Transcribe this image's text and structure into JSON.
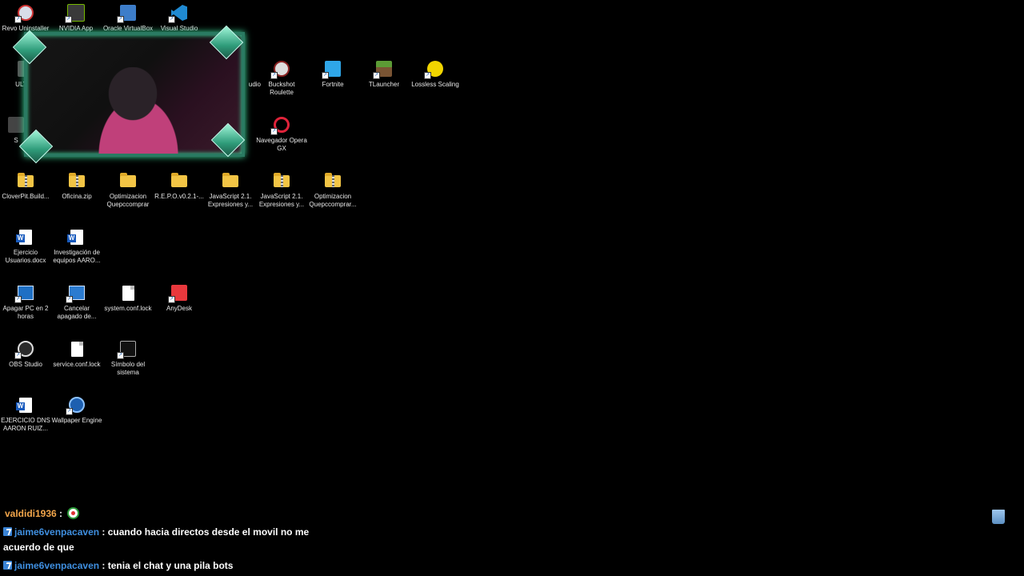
{
  "desktop": {
    "icons": {
      "revo": "Revo Uninstaller",
      "nvidia": "NVIDIA App",
      "virtualbox": "Oracle VirtualBox",
      "vscode": "Visual Studio Code",
      "buckshot": "Buckshot Roulette",
      "fortnite": "Fortnite",
      "tlauncher": "TLauncher",
      "lossless": "Lossless Scaling",
      "opera": "Navegador Opera GX",
      "cloverpit": "CloverPit.Build...",
      "oficina": "Oficina.zip",
      "optim1": "Optimizacion Quepccomprar",
      "repo": "R.E.P.O.v0.2.1-...",
      "js1": "JavaScript 2.1. Expresiones y...",
      "js2": "JavaScript 2.1. Expresiones y...",
      "optim2": "Optimizacion Quepccomprar...",
      "ejercicio_usuarios": "Ejercicio Usuarios.docx",
      "investigacion": "Investigación de equipos AARO...",
      "apagar": "Apagar PC en 2 horas",
      "cancelar": "Cancelar apagado de...",
      "sysconf": "system.conf.lock",
      "anydesk": "AnyDesk",
      "obs": "OBS Studio",
      "serviceconf": "service.conf.lock",
      "cmd": "Símbolo del sistema",
      "ejercicio_dns": "EJERCICIO DNS AARON RUIZ...",
      "wallpaper": "Wallpaper Engine",
      "partial_ultra": "ULTRA",
      "partial_s": "S",
      "partial_studio": "udio"
    }
  },
  "chat": {
    "messages": [
      {
        "user": "valdidi1936",
        "sep": " :",
        "text": ""
      },
      {
        "user": "jaime6venpacaven",
        "sep": " :",
        "text": " cuando hacia directos desde el movil no me acuerdo de que"
      },
      {
        "user": "jaime6venpacaven",
        "sep": " :",
        "text": " tenia el chat y una pila bots"
      }
    ]
  },
  "colors": {
    "user_orange": "#f2a64b",
    "user_blue": "#3f8fe0",
    "cam_glow": "#3fe0a0"
  }
}
